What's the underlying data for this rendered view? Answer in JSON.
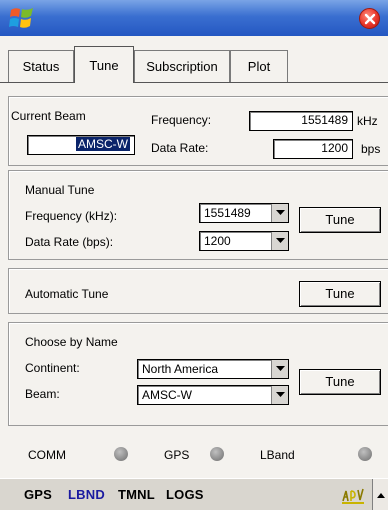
{
  "titlebar": {
    "logo_icon": "windows-flag-icon",
    "close_icon": "close-icon"
  },
  "tabs": [
    {
      "label": "Status",
      "active": false
    },
    {
      "label": "Tune",
      "active": true
    },
    {
      "label": "Subscription",
      "active": false
    },
    {
      "label": "Plot",
      "active": false
    }
  ],
  "current_beam": {
    "label": "Current Beam",
    "beam_value": "AMSC-W",
    "frequency_label": "Frequency:",
    "frequency_value": "1551489",
    "frequency_unit": "kHz",
    "data_rate_label": "Data Rate:",
    "data_rate_value": "1200",
    "data_rate_unit": "bps"
  },
  "manual_tune": {
    "label": "Manual Tune",
    "frequency_label": "Frequency (kHz):",
    "frequency_value": "1551489",
    "data_rate_label": "Data Rate (bps):",
    "data_rate_value": "1200",
    "button": "Tune"
  },
  "automatic_tune": {
    "label": "Automatic Tune",
    "button": "Tune"
  },
  "choose_by_name": {
    "label": "Choose by Name",
    "continent_label": "Continent:",
    "continent_value": "North America",
    "beam_label": "Beam:",
    "beam_value": "AMSC-W",
    "button": "Tune"
  },
  "status": {
    "comm": "COMM",
    "gps": "GPS",
    "lband": "LBand",
    "led_color": "#8e8e8e"
  },
  "bottom_menu": {
    "items": [
      {
        "label": "GPS",
        "color": "#000000"
      },
      {
        "label": "LBND",
        "color": "#1a1aa0"
      },
      {
        "label": "TMNL",
        "color": "#000000"
      },
      {
        "label": "LOGS",
        "color": "#000000"
      }
    ],
    "sip_icon": "keyboard-input-icon"
  },
  "colors": {
    "title_bar": "#2457c2",
    "selection": "#0a246a",
    "background": "#f4f2ee"
  }
}
